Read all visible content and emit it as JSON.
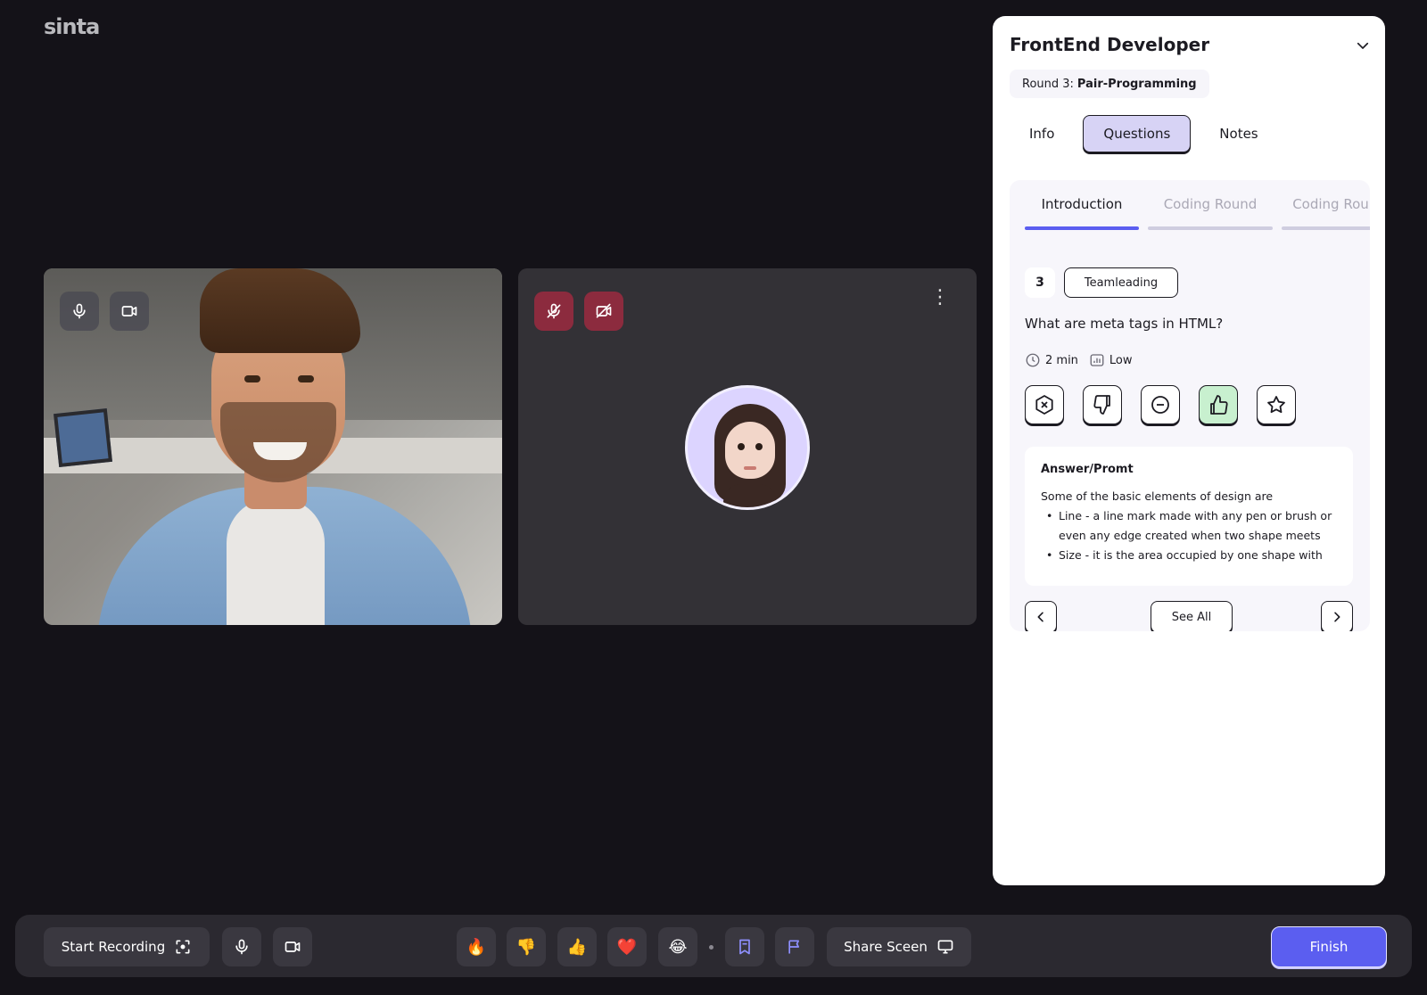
{
  "app": {
    "logo": "sinta"
  },
  "participants": {
    "self": {
      "name": "Interviewer video",
      "mic": "on",
      "camera": "on"
    },
    "remote": {
      "name": "Candidate avatar",
      "mic": "muted",
      "camera": "off",
      "more_label": "⋮"
    }
  },
  "panel": {
    "title": "FrontEnd Developer",
    "round_prefix": "Round 3:",
    "round_name": "Pair-Programming",
    "tabs": [
      {
        "label": "Info",
        "active": false
      },
      {
        "label": "Questions",
        "active": true
      },
      {
        "label": "Notes",
        "active": false
      }
    ],
    "sub_tabs": [
      {
        "label": "Introduction",
        "active": true
      },
      {
        "label": "Coding Round",
        "active": false
      },
      {
        "label": "Coding Rou",
        "active": false
      }
    ],
    "question": {
      "number": "3",
      "tag": "Teamleading",
      "text": "What are meta tags in HTML?",
      "duration": "2 min",
      "difficulty": "Low",
      "ratings": [
        {
          "icon": "hexagon-x-icon",
          "selected": false
        },
        {
          "icon": "thumbs-down-icon",
          "selected": false
        },
        {
          "icon": "minus-circle-icon",
          "selected": false
        },
        {
          "icon": "thumbs-up-icon",
          "selected": true
        },
        {
          "icon": "star-icon",
          "selected": false
        }
      ]
    },
    "answer": {
      "heading": "Answer/Promt",
      "intro": "Some of the basic elements of design are",
      "bullets": [
        "Line - a line mark made with any pen or brush or even any edge created when two shape meets",
        "Size - it is the area occupied by one shape with"
      ]
    },
    "see_all": "See All"
  },
  "bottombar": {
    "start_recording": "Start Recording",
    "reactions": [
      "🔥",
      "👎",
      "👍",
      "❤️",
      "😂"
    ],
    "share_screen": "Share Sceen",
    "finish": "Finish"
  },
  "colors": {
    "background": "#141218",
    "accent": "#5b5ef0",
    "danger": "#8c2b3e",
    "selected_rating": "#c8f0cf",
    "active_tab": "#d7d3f5"
  }
}
